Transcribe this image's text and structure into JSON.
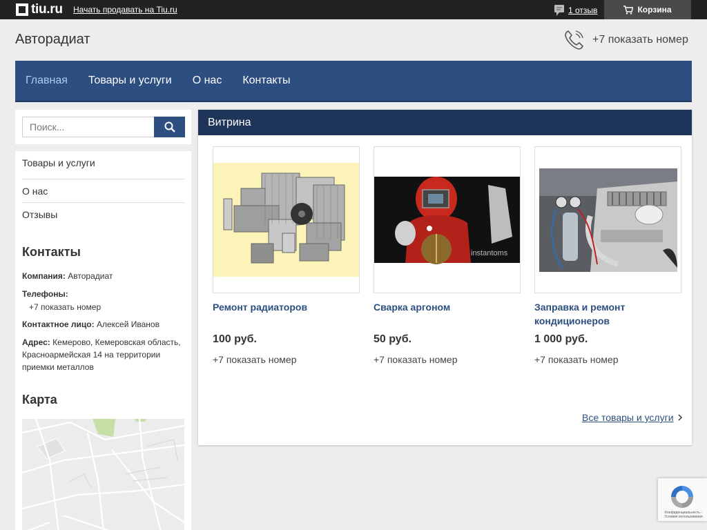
{
  "topbar": {
    "logo_text": "tiu.ru",
    "sell_link": "Начать продавать на Tiu.ru",
    "reviews_link": "1 отзыв",
    "cart_label": "Корзина"
  },
  "header": {
    "company_name": "Авторадиат",
    "phone_label": "+7 показать номер"
  },
  "nav": {
    "items": [
      {
        "label": "Главная"
      },
      {
        "label": "Товары и услуги"
      },
      {
        "label": "О нас"
      },
      {
        "label": "Контакты"
      }
    ]
  },
  "search": {
    "placeholder": "Поиск..."
  },
  "sidebar": {
    "menu": [
      {
        "label": "Товары и услуги"
      },
      {
        "label": "О нас"
      },
      {
        "label": "Отзывы"
      }
    ],
    "contacts_heading": "Контакты",
    "company_label": "Компания:",
    "company_value": "Авторадиат",
    "phones_label": "Телефоны:",
    "phones_value": "+7 показать номер",
    "person_label": "Контактное лицо:",
    "person_value": "Алексей Иванов",
    "address_label": "Адрес:",
    "address_value": "Кемерово, Кемеровская область, Красноармейская 14 на территории приемки металлов",
    "map_heading": "Карта"
  },
  "showcase": {
    "title": "Витрина",
    "products": [
      {
        "name": "Ремонт радиаторов",
        "price": "100 руб.",
        "phone": "+7 показать номер"
      },
      {
        "name": "Сварка аргоном",
        "price": "50 руб.",
        "phone": "+7 показать номер",
        "watermark": "instantoms"
      },
      {
        "name": "Заправка и ремонт кондиционеров",
        "price": "1 000 руб.",
        "phone": "+7 показать номер"
      }
    ],
    "all_link": "Все товары и услуги"
  },
  "recaptcha": {
    "text": "Конфиденциальность - Условия использования"
  },
  "colors": {
    "topbar": "#222222",
    "nav": "#2c4e80",
    "showcase_header": "#1f3459",
    "link": "#2c4e80",
    "background": "#ededed"
  }
}
